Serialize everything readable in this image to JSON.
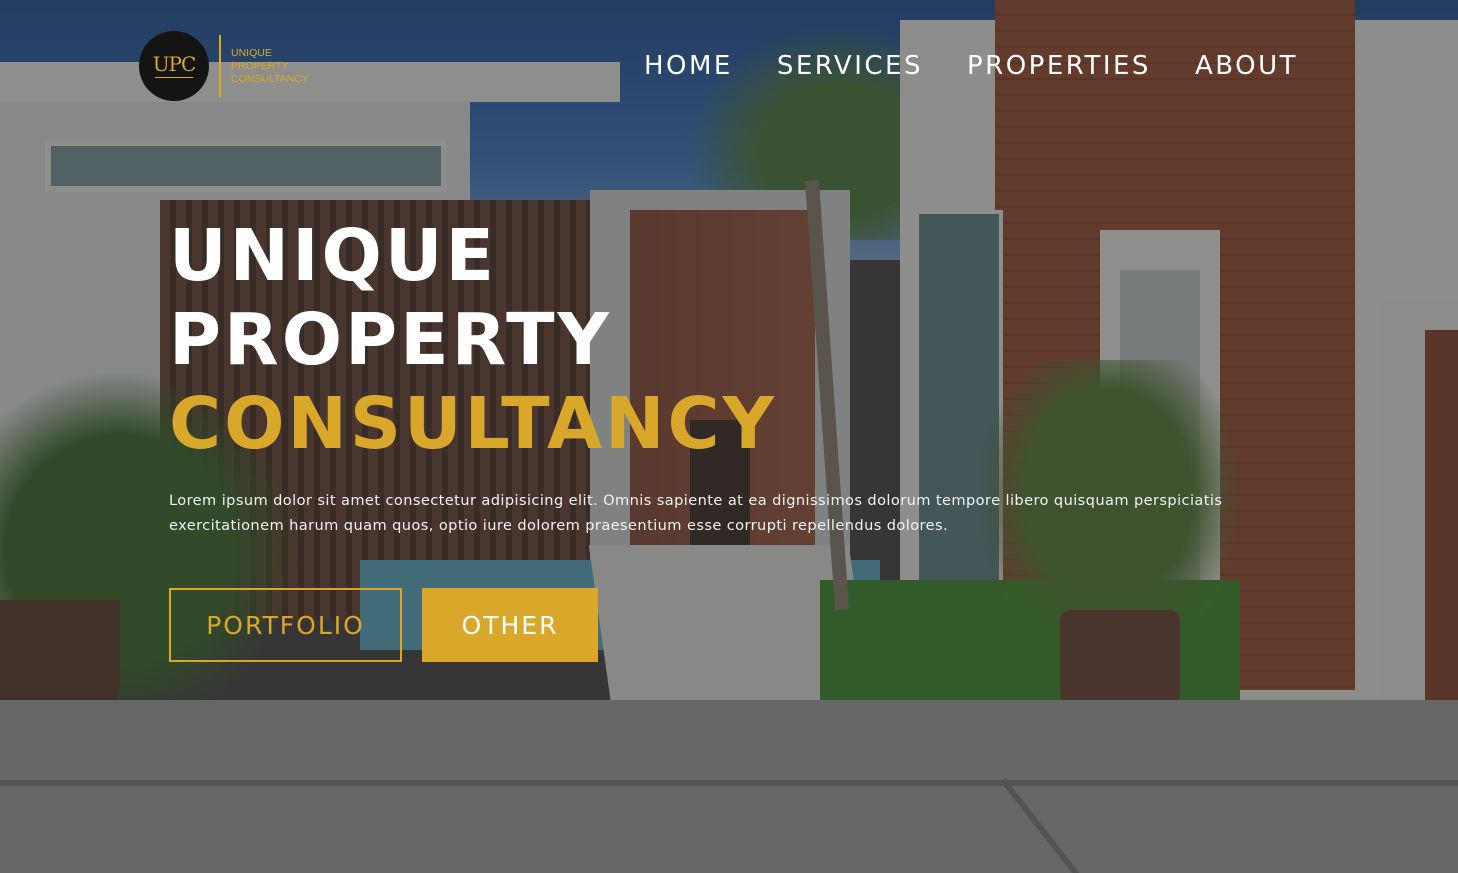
{
  "brand": {
    "logo_mark": "UPC",
    "name_lines": [
      "UNIQUE",
      "PROPERTY",
      "CONSULTANCY"
    ]
  },
  "nav": {
    "items": [
      "HOME",
      "SERVICES",
      "PROPERTIES",
      "ABOUT"
    ]
  },
  "hero": {
    "title_line1": "UNIQUE",
    "title_line2": "PROPERTY",
    "title_line3": "CONSULTANCY",
    "description": "Lorem ipsum dolor sit amet consectetur adipisicing elit. Omnis sapiente at ea dignissimos dolorum tempore libero quisquam perspiciatis exercitationem harum quam quos, optio iure dolorem praesentium esse corrupti repellendus dolores.",
    "primary_button": "PORTFOLIO",
    "secondary_button": "OTHER"
  },
  "colors": {
    "accent": "#d9a82a",
    "text": "#ffffff"
  }
}
